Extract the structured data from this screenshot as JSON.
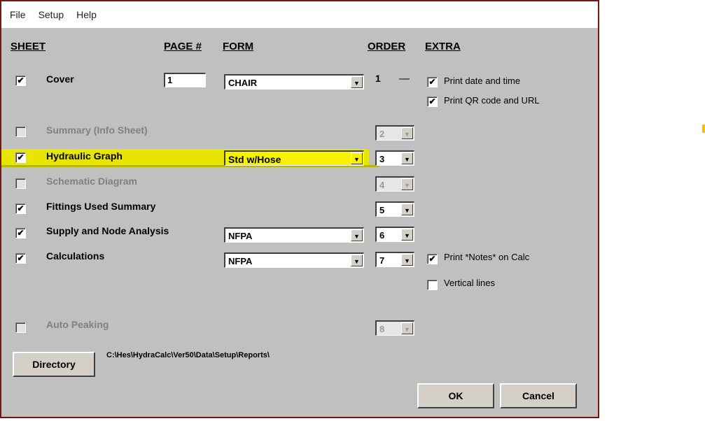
{
  "menu": [
    "File",
    "Setup",
    "Help"
  ],
  "headers": {
    "sheet": "SHEET",
    "page": "PAGE #",
    "form": "FORM",
    "order": "ORDER",
    "extra": "EXTRA"
  },
  "rows": {
    "cover": {
      "label": "Cover",
      "checked": "✔",
      "page": "1",
      "form": "CHAIR",
      "order": "1",
      "dash": "—"
    },
    "summary": {
      "label": "Summary (Info Sheet)",
      "order": "2"
    },
    "hydraulic": {
      "label": "Hydraulic Graph",
      "checked": "✔",
      "form": "Std w/Hose",
      "order": "3"
    },
    "schematic": {
      "label": "Schematic Diagram",
      "order": "4"
    },
    "fittings": {
      "label": "Fittings Used Summary",
      "checked": "✔",
      "order": "5"
    },
    "supply": {
      "label": "Supply and Node Analysis",
      "checked": "✔",
      "form": "NFPA",
      "order": "6"
    },
    "calculations": {
      "label": "Calculations",
      "checked": "✔",
      "form": "NFPA",
      "order": "7"
    },
    "peaking": {
      "label": "Auto Peaking",
      "order": "8"
    }
  },
  "extra": {
    "print_date": {
      "label": "Print date and time",
      "checked": "✔"
    },
    "print_qr": {
      "label": "Print QR code and URL",
      "checked": "✔"
    },
    "print_notes": {
      "label": "Print *Notes* on Calc",
      "checked": "✔"
    },
    "vertical": {
      "label": "Vertical lines",
      "checked": ""
    }
  },
  "directory": {
    "button": "Directory",
    "path": "C:\\Hes\\HydraCalc\\Ver50\\Data\\Setup\\Reports\\"
  },
  "buttons": {
    "ok": "OK",
    "cancel": "Cancel"
  },
  "glyphs": {
    "arrow": "▼"
  },
  "colors": {
    "highlight": "#e7e600",
    "frame": "#7a1515",
    "accent_mark": "#f2c200"
  }
}
